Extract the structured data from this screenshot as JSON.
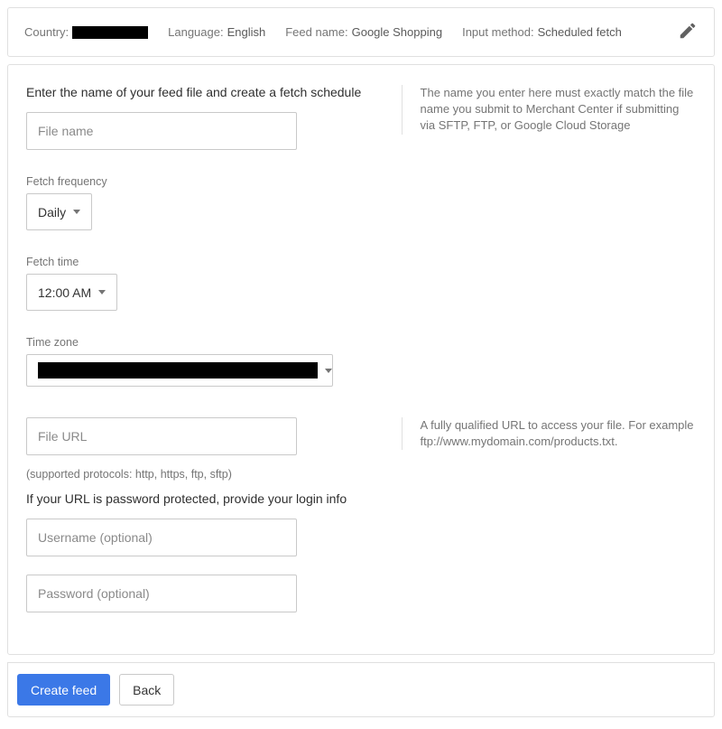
{
  "summary": {
    "country_label": "Country:",
    "language_label": "Language:",
    "language_value": "English",
    "feed_name_label": "Feed name:",
    "feed_name_value": "Google Shopping",
    "input_method_label": "Input method:",
    "input_method_value": "Scheduled fetch"
  },
  "form": {
    "title": "Enter the name of your feed file and create a fetch schedule",
    "file_name_placeholder": "File name",
    "file_name_help": "The name you enter here must exactly match the file name you submit to Merchant Center if submitting via SFTP, FTP, or Google Cloud Storage",
    "fetch_frequency_label": "Fetch frequency",
    "fetch_frequency_value": "Daily",
    "fetch_time_label": "Fetch time",
    "fetch_time_value": "12:00 AM",
    "time_zone_label": "Time zone",
    "file_url_placeholder": "File URL",
    "file_url_help": "A fully qualified URL to access your file. For example ftp://www.mydomain.com/products.txt.",
    "protocols_hint": "(supported protocols: http, https, ftp, sftp)",
    "password_note": "If your URL is password protected, provide your login info",
    "username_placeholder": "Username (optional)",
    "password_placeholder": "Password (optional)"
  },
  "footer": {
    "create_label": "Create feed",
    "back_label": "Back"
  }
}
